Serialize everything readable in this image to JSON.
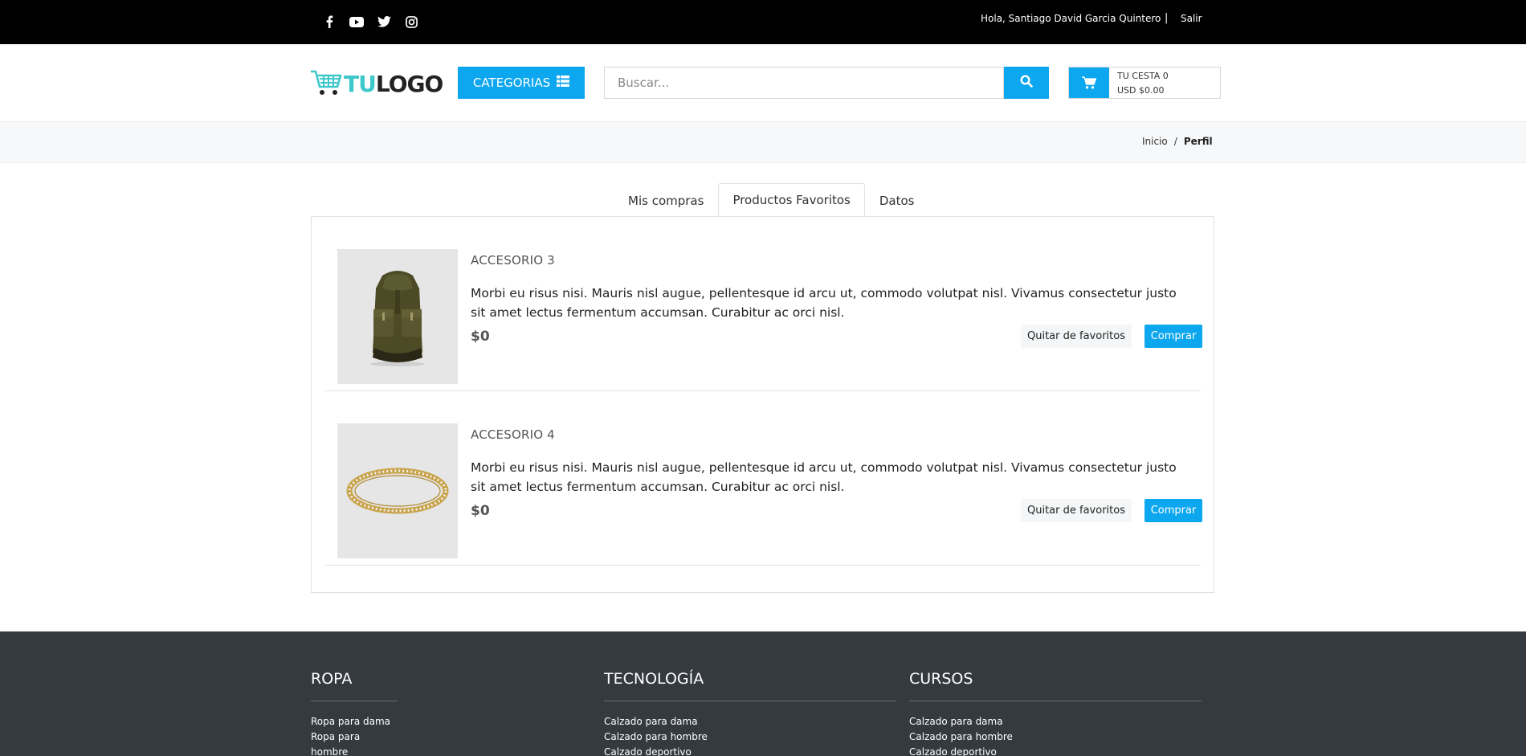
{
  "topbar": {
    "social_icons": [
      "facebook-icon",
      "youtube-icon",
      "twitter-icon",
      "instagram-icon"
    ],
    "greeting": "Hola, Santiago David Garcia Quintero",
    "separator": "|",
    "logout": "Salir"
  },
  "header": {
    "logo_tu": "TU",
    "logo_logo": "LOGO",
    "categories_label": "CATEGORIAS",
    "search_placeholder": "Buscar...",
    "cart_line1": "TU CESTA 0",
    "cart_line2": "USD $0.00"
  },
  "breadcrumb": {
    "home": "Inicio",
    "separator": "/",
    "current": "Perfil"
  },
  "tabs": [
    {
      "label": "Mis compras"
    },
    {
      "label": "Productos Favoritos"
    },
    {
      "label": "Datos"
    }
  ],
  "favorites": [
    {
      "title": "ACCESORIO 3",
      "description": "Morbi eu risus nisi. Mauris nisl augue, pellentesque id arcu ut, commodo volutpat nisl. Vivamus consectetur justo sit amet lectus fermentum accumsan. Curabitur ac orci nisl.",
      "price": "$0",
      "remove_label": "Quitar de favoritos",
      "buy_label": "Comprar"
    },
    {
      "title": "ACCESORIO 4",
      "description": "Morbi eu risus nisi. Mauris nisl augue, pellentesque id arcu ut, commodo volutpat nisl. Vivamus consectetur justo sit amet lectus fermentum accumsan. Curabitur ac orci nisl.",
      "price": "$0",
      "remove_label": "Quitar de favoritos",
      "buy_label": "Comprar"
    }
  ],
  "footer": {
    "columns": [
      {
        "heading": "ROPA",
        "links": [
          "Ropa para dama",
          "Ropa para",
          "hombre"
        ]
      },
      {
        "heading": "TECNOLOGÍA",
        "links": [
          "Calzado para dama",
          "Calzado para hombre",
          "Calzado deportivo"
        ]
      },
      {
        "heading": "CURSOS",
        "links": [
          "Calzado para dama",
          "Calzado para hombre",
          "Calzado deportivo"
        ]
      }
    ]
  },
  "colors": {
    "accent": "#0da7ef",
    "logo_teal": "#3ec8cc",
    "topbar_bg": "#000000",
    "footer_bg": "#343a40"
  }
}
